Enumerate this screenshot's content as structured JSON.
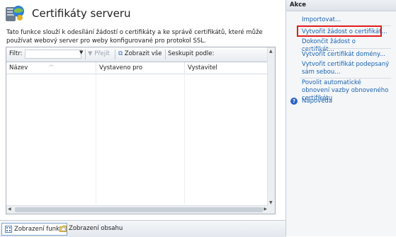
{
  "header": {
    "title": "Certifikáty serveru",
    "description": "Tato funkce slouží k odesílání žádostí o certifikáty a ke správě certifikátů, které může používat webový server pro weby konfigurované pro protokol SSL."
  },
  "toolbar": {
    "filter_label": "Filtr:",
    "filter_value": "",
    "go_label": "Přejít",
    "show_all_label": "Zobrazit vše",
    "group_by_label": "Seskupit podle:"
  },
  "columns": [
    "Název",
    "Vystaveno pro",
    "Vystavitel"
  ],
  "actions": {
    "title": "Akce",
    "items": [
      "Importovat...",
      "Vytvořit žádost o certifikát...",
      "Dokončit žádost o certifikát...",
      "Vytvořit certifikát domény...",
      "Vytvořit certifikát podepsaný sám sebou...",
      "Povolit automatické obnovení vazby obnoveného certifikátu"
    ],
    "help": "Nápověda"
  },
  "bottom_tabs": [
    "Zobrazení funkcí",
    "Zobrazení obsahu"
  ],
  "colors": {
    "link": "#1a63b0",
    "highlight": "#e21d1d"
  }
}
